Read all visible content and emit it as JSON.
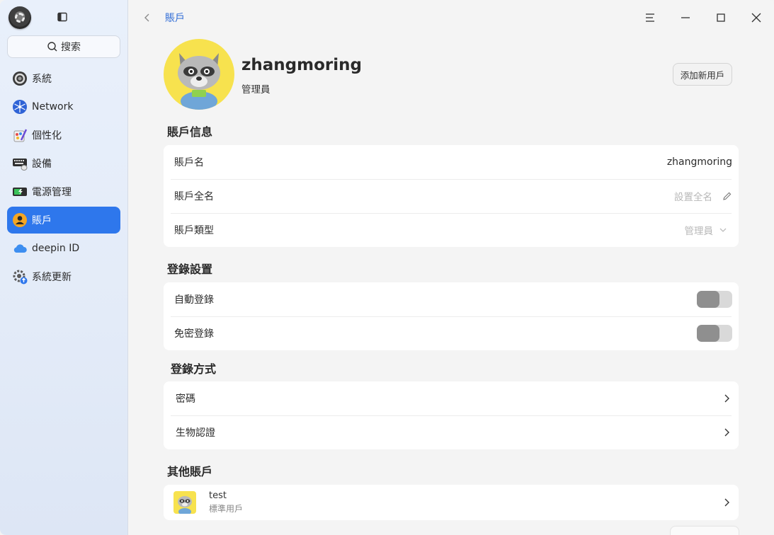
{
  "sidebar": {
    "search_label": "搜索",
    "items": [
      {
        "label": "系統",
        "icon": "system-icon"
      },
      {
        "label": "Network",
        "icon": "network-icon"
      },
      {
        "label": "個性化",
        "icon": "personalization-icon"
      },
      {
        "label": "設備",
        "icon": "device-icon"
      },
      {
        "label": "電源管理",
        "icon": "power-icon"
      },
      {
        "label": "賬戶",
        "icon": "account-icon",
        "active": true
      },
      {
        "label": "deepin ID",
        "icon": "cloud-icon"
      },
      {
        "label": "系統更新",
        "icon": "update-icon"
      }
    ]
  },
  "header": {
    "breadcrumb": "賬戶"
  },
  "profile": {
    "username": "zhangmoring",
    "type": "管理員",
    "add_button": "添加新用戶"
  },
  "account_info": {
    "title": "賬戶信息",
    "name_label": "賬戶名",
    "name_value": "zhangmoring",
    "fullname_label": "賬戶全名",
    "fullname_placeholder": "設置全名",
    "type_label": "賬戶類型",
    "type_value": "管理員"
  },
  "login_settings": {
    "title": "登錄設置",
    "auto_login_label": "自動登錄",
    "auto_login_on": false,
    "nopass_login_label": "免密登錄",
    "nopass_login_on": false
  },
  "login_methods": {
    "title": "登錄方式",
    "password_label": "密碼",
    "biometric_label": "生物認證"
  },
  "other_accounts": {
    "title": "其他賬戶",
    "items": [
      {
        "name": "test",
        "type": "標準用戶"
      }
    ]
  },
  "colors": {
    "accent": "#2e77ec",
    "sidebar_bg": "#e6eef9"
  }
}
